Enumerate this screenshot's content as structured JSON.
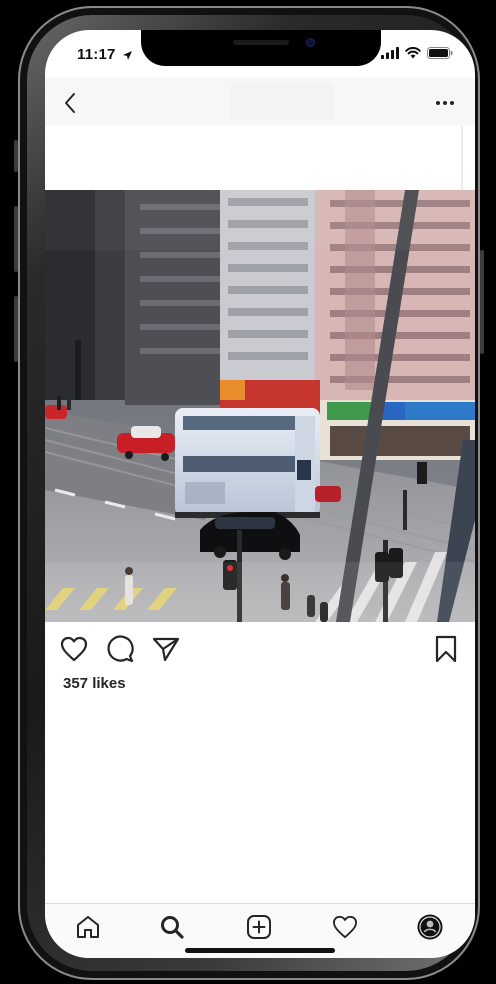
{
  "status_bar": {
    "time": "11:17"
  },
  "post": {
    "likes_text": "357 likes"
  },
  "icons": {
    "back": "chevron-left-icon",
    "more": "more-horizontal-icon",
    "like": "heart-icon",
    "comment": "comment-icon",
    "share": "send-icon",
    "save": "bookmark-icon",
    "tab_home": "home-icon",
    "tab_search": "search-icon",
    "tab_new_post": "add-post-icon",
    "tab_activity": "heart-icon",
    "tab_profile": "avatar"
  },
  "colors": {
    "text": "#262626",
    "icon": "#262626",
    "tab_bar": "#fafafa",
    "header": "#f7f7f7"
  }
}
